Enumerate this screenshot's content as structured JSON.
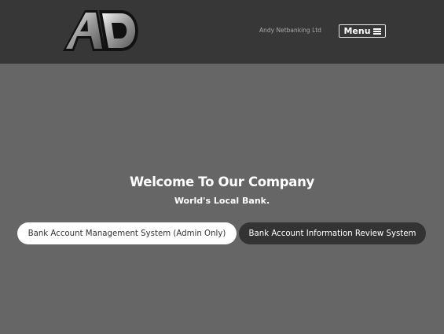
{
  "header": {
    "company_name": "Andy Netbanking Ltd",
    "menu_label": "Menu",
    "menu_icon": "hamburger-icon",
    "logo_icon": "ad-logo-icon"
  },
  "hero": {
    "title": "Welcome To Our Company",
    "subtitle": "World's Local Bank."
  },
  "actions": {
    "admin_label": "Bank Account Management System (Admin Only)",
    "review_label": "Bank Account Information Review System"
  },
  "colors": {
    "header_bg": "#373737",
    "page_bg": "#666666",
    "button_dark": "#333333",
    "button_light": "#ffffff"
  }
}
